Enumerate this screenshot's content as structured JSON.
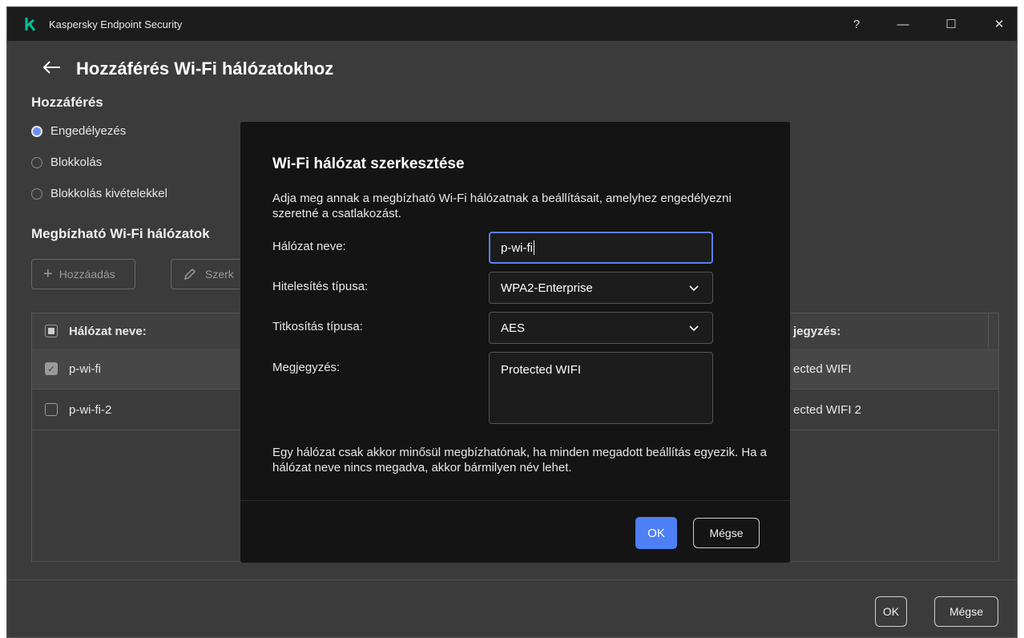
{
  "app": {
    "title": "Kaspersky Endpoint Security",
    "help_symbol": "?",
    "minimize_symbol": "—",
    "maximize_symbol": "☐",
    "close_symbol": "✕"
  },
  "page": {
    "title": "Hozzáférés Wi-Fi hálózatokhoz",
    "access_section": "Hozzáférés",
    "access_options": [
      {
        "label": "Engedélyezés",
        "selected": true
      },
      {
        "label": "Blokkolás",
        "selected": false
      },
      {
        "label": "Blokkolás kivételekkel",
        "selected": false
      }
    ],
    "trusted_section": "Megbízható Wi-Fi hálózatok",
    "toolbar": {
      "add_label": "Hozzáadás",
      "edit_label": "Szerk"
    },
    "table": {
      "col_name": "Hálózat neve:",
      "col_comment": "jegyzés:",
      "rows": [
        {
          "name": "p-wi-fi",
          "comment": "ected WIFI",
          "checked": true
        },
        {
          "name": "p-wi-fi-2",
          "comment": "ected WIFI 2",
          "checked": false
        }
      ]
    },
    "footer": {
      "ok_label": "OK",
      "cancel_label": "Mégse"
    }
  },
  "dialog": {
    "title": "Wi-Fi hálózat szerkesztése",
    "description": "Adja meg annak a megbízható Wi-Fi hálózatnak a beállításait, amelyhez engedélyezni szeretné a csatlakozást.",
    "network_name_label": "Hálózat neve:",
    "network_name_value": "p-wi-fi",
    "auth_type_label": "Hitelesítés típusa:",
    "auth_type_value": "WPA2-Enterprise",
    "encryption_label": "Titkosítás típusa:",
    "encryption_value": "AES",
    "comment_label": "Megjegyzés:",
    "comment_value": "Protected WIFI",
    "note": "Egy hálózat csak akkor minősül megbízhatónak, ha minden megadott beállítás egyezik. Ha a hálózat neve nincs megadva, akkor bármilyen név lehet.",
    "ok_label": "OK",
    "cancel_label": "Mégse"
  },
  "colors": {
    "accent": "#4e7ff5",
    "brand": "#00a88e",
    "background": "#3b3b3b",
    "dialog_background": "#141414"
  }
}
